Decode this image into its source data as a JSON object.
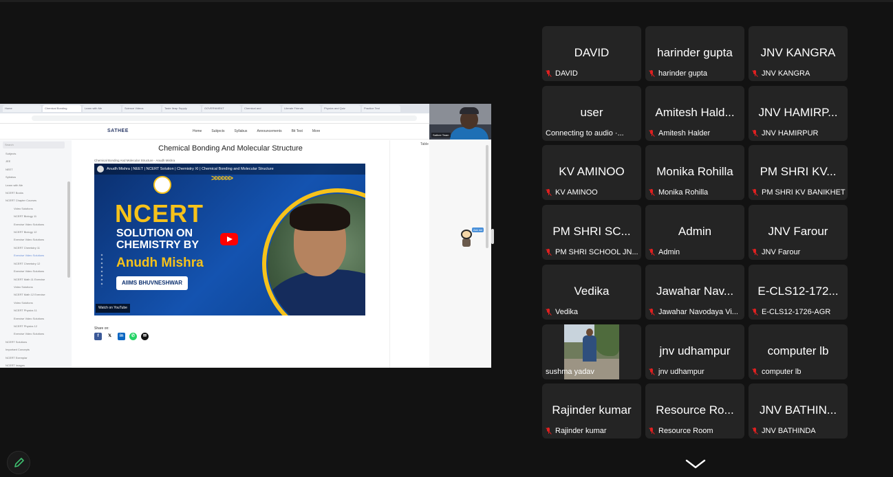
{
  "browser": {
    "tabs": [
      "Home",
      "Chemical Bonding",
      "Learn with Me",
      "Science Videos",
      "Taste Ileap Supply",
      "GOVERNMENT",
      "Chemical and",
      "Literate Friends",
      "Physics and Quiz",
      "Practice Test"
    ],
    "presenter_name": "Sathee Team"
  },
  "site": {
    "brand": "SATHEE",
    "nav": [
      "Home",
      "Subjects",
      "Syllabus",
      "Announcements",
      "Bit Test",
      "More"
    ],
    "search_placeholder": "Search",
    "sidebar_items": [
      "Subjects",
      "JEE",
      "NEET",
      "Syllabus",
      "Learn with Me",
      "NCERT Books",
      "NCERT Chapter Courses",
      "Video Solutions",
      "NCERT Biology 11",
      "Exercise Video Solutions",
      "NCERT Biology 12",
      "Exercise Video Solutions",
      "NCERT Chemistry 11",
      "Exercise Video Solutions",
      "NCERT Chemistry 12",
      "Exercise Video Solutions",
      "NCERT Math 11 Exercise",
      "Video Solutions",
      "NCERT Math 12 Exercise",
      "Video Solutions",
      "NCERT Physics 11",
      "Exercise Video Solutions",
      "NCERT Physics 12",
      "Exercise Video Solutions",
      "NCERT Solutions",
      "Important Concepts",
      "NCERT Exemplar",
      "NCERT Images"
    ],
    "page_title": "Chemical Bonding And Molecular Structure",
    "breadcrumb": "Chemical Bonding And Molecular Structure - Anudh Mishra",
    "toc_title": "Table of Contents",
    "share_label": "Share on:",
    "bot_tag": "Ask me"
  },
  "video": {
    "title": "Anudh Mishra | NEET | NCERT Solution | Chemistry XI | Chemical Bonding and Molecular Structure",
    "headline": "NCERT",
    "subline": "SOLUTION ON CHEMISTRY BY",
    "author": "Anudh Mishra",
    "badge": "AIIMS BHUVNESHWAR",
    "watch_on": "Watch on YouTube",
    "arrows": ">>>>>>"
  },
  "participants": [
    {
      "display": "DAVID",
      "label": "DAVID",
      "muted": true
    },
    {
      "display": "harinder gupta",
      "label": "harinder gupta",
      "muted": true
    },
    {
      "display": "JNV KANGRA",
      "label": "JNV KANGRA",
      "muted": true
    },
    {
      "display": "user",
      "label": "Connecting to audio ·...",
      "muted": false
    },
    {
      "display": "Amitesh Hald...",
      "label": "Amitesh Halder",
      "muted": true
    },
    {
      "display": "JNV HAMIRP...",
      "label": "JNV HAMIRPUR",
      "muted": true
    },
    {
      "display": "KV AMINOO",
      "label": "KV AMINOO",
      "muted": true
    },
    {
      "display": "Monika Rohilla",
      "label": "Monika Rohilla",
      "muted": true
    },
    {
      "display": "PM SHRI KV...",
      "label": "PM SHRI KV BANIKHET",
      "muted": true
    },
    {
      "display": "PM SHRI SC...",
      "label": "PM SHRI SCHOOL JN...",
      "muted": true
    },
    {
      "display": "Admin",
      "label": "Admin",
      "muted": true
    },
    {
      "display": "JNV Farour",
      "label": "JNV Farour",
      "muted": true
    },
    {
      "display": "Vedika",
      "label": "Vedika",
      "muted": true
    },
    {
      "display": "Jawahar Nav...",
      "label": "Jawahar Navodaya Vi...",
      "muted": true
    },
    {
      "display": "E-CLS12-172...",
      "label": "E-CLS12-1726-AGR",
      "muted": true
    },
    {
      "display": "",
      "label": "sushma yadav",
      "muted": false,
      "video": true
    },
    {
      "display": "jnv udhampur",
      "label": "jnv udhampur",
      "muted": true
    },
    {
      "display": "computer lb",
      "label": "computer lb",
      "muted": true
    },
    {
      "display": "Rajinder kumar",
      "label": "Rajinder kumar",
      "muted": true
    },
    {
      "display": "Resource Ro...",
      "label": "Resource Room",
      "muted": true
    },
    {
      "display": "JNV BATHIN...",
      "label": "JNV BATHINDA",
      "muted": true
    }
  ],
  "colors": {
    "background": "#121212",
    "tile": "#242424",
    "mic_muted": "#e02020",
    "accent_yellow": "#f6c21b"
  }
}
